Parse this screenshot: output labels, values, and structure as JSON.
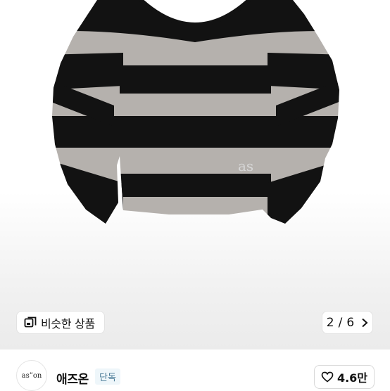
{
  "product_image": {
    "knit_logo_text": "as",
    "stripe_dark": "#121212",
    "stripe_light": "#b5b1ad"
  },
  "similar_products": {
    "label": "비슷한 상품",
    "icon": "similar-items-icon"
  },
  "pagination": {
    "current": "2",
    "separator": "/",
    "total": "6",
    "icon": "chevron-right-icon"
  },
  "brand": {
    "logo_text": "as”on",
    "name": "애즈온",
    "badge": "단독"
  },
  "like": {
    "count": "4.6만",
    "icon": "heart-outline-icon"
  }
}
